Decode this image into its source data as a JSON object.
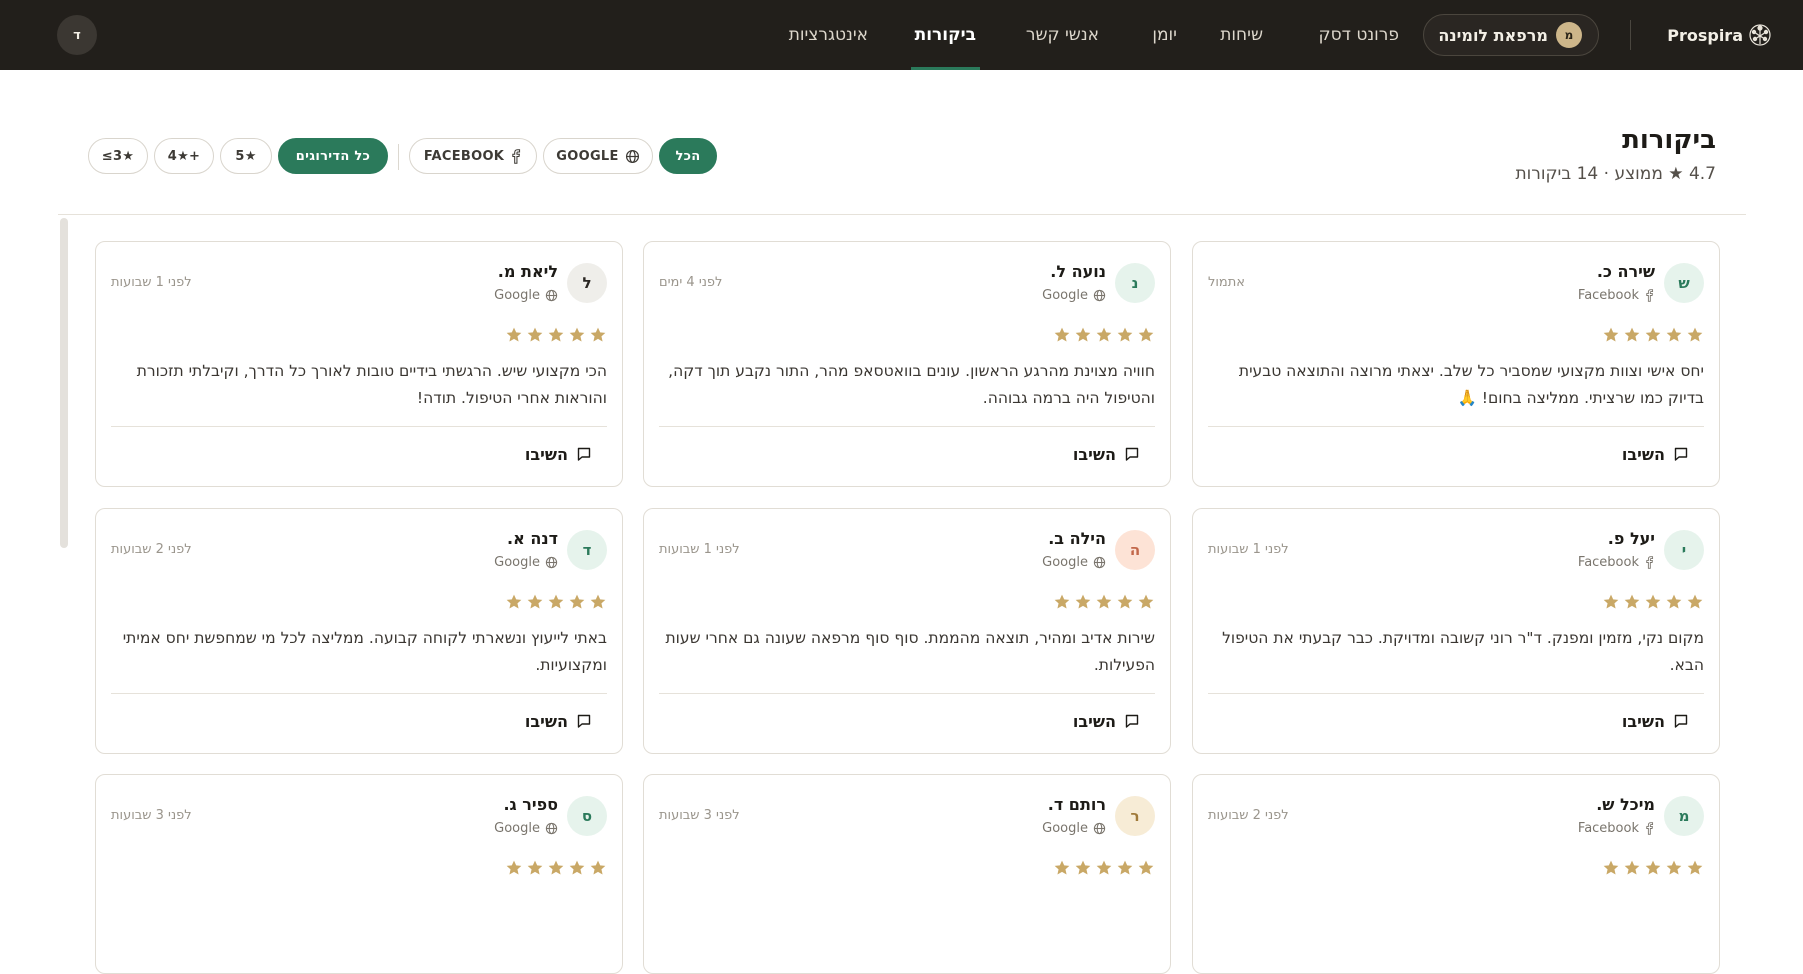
{
  "brand": {
    "name": "Prospira"
  },
  "clinic": {
    "initial": "מ",
    "name": "מרפאת לומינה"
  },
  "nav": [
    {
      "label": "פרונט דסק"
    },
    {
      "label": "שיחות"
    },
    {
      "label": "יומן"
    },
    {
      "label": "אנשי קשר"
    },
    {
      "label": "ביקורות",
      "active": true
    },
    {
      "label": "אינטגרציות"
    }
  ],
  "user": {
    "initial": "ד"
  },
  "header": {
    "title": "ביקורות",
    "subtitle": "4.7 ★ ממוצע · 14 ביקורות"
  },
  "filters": {
    "source": [
      {
        "label": "הכל",
        "active": true
      },
      {
        "label": "GOOGLE",
        "icon": "globe-icon"
      },
      {
        "label": "FACEBOOK",
        "icon": "facebook-icon"
      }
    ],
    "rating": [
      {
        "label": "כל הדירוגים",
        "active": true
      },
      {
        "label": "5★"
      },
      {
        "label": "4★+"
      },
      {
        "label": "≤3★"
      }
    ]
  },
  "reply_label": "השיבו",
  "colors": {
    "accent": "#2b7a5b",
    "star": "#c9a866",
    "topbar": "#221f1b"
  },
  "reviews": [
    {
      "initial": "ש",
      "name": "שירה כ.",
      "source": "Facebook",
      "time": "אתמול",
      "rating": 5,
      "text": "יחס אישי וצוות מקצועי שמסביר כל שלב. יצאתי מרוצה והתוצאה טבעית בדיוק כמו שרציתי. ממליצה בחום! 🙏"
    },
    {
      "initial": "נ",
      "name": "נועה ל.",
      "source": "Google",
      "time": "לפני 4 ימים",
      "rating": 5,
      "text": "חוויה מצוינת מהרגע הראשון. עונים בוואטסאפ מהר, התור נקבע תוך דקה, והטיפול היה ברמה גבוהה."
    },
    {
      "initial": "ל",
      "name": "ליאת מ.",
      "source": "Google",
      "time": "לפני 1 שבועות",
      "rating": 5,
      "text": "הכי מקצועי שיש. הרגשתי בידיים טובות לאורך כל הדרך, וקיבלתי תזכורת והוראות אחרי הטיפול. תודה!"
    },
    {
      "initial": "י",
      "name": "יעל פ.",
      "source": "Facebook",
      "time": "לפני 1 שבועות",
      "rating": 5,
      "text": "מקום נקי, מזמין ומפנק. ד\"ר רוני קשובה ומדויקת. כבר קבעתי את הטיפול הבא."
    },
    {
      "initial": "ה",
      "name": "הילה ב.",
      "source": "Google",
      "time": "לפני 1 שבועות",
      "rating": 5,
      "text": "שירות אדיב ומהיר, תוצאה מהממת. סוף סוף מרפאה שעונה גם אחרי שעות הפעילות."
    },
    {
      "initial": "ד",
      "name": "דנה א.",
      "source": "Google",
      "time": "לפני 2 שבועות",
      "rating": 5,
      "text": "באתי לייעוץ ונשארתי לקוחה קבועה. ממליצה לכל מי שמחפשת יחס אמיתי ומקצועיות."
    },
    {
      "initial": "מ",
      "name": "מיכל ש.",
      "source": "Facebook",
      "time": "לפני 2 שבועות",
      "rating": 5,
      "text": ""
    },
    {
      "initial": "ר",
      "name": "רותם ד.",
      "source": "Google",
      "time": "לפני 3 שבועות",
      "rating": 5,
      "text": ""
    },
    {
      "initial": "ס",
      "name": "ספיר ג.",
      "source": "Google",
      "time": "לפני 3 שבועות",
      "rating": 5,
      "text": ""
    }
  ]
}
